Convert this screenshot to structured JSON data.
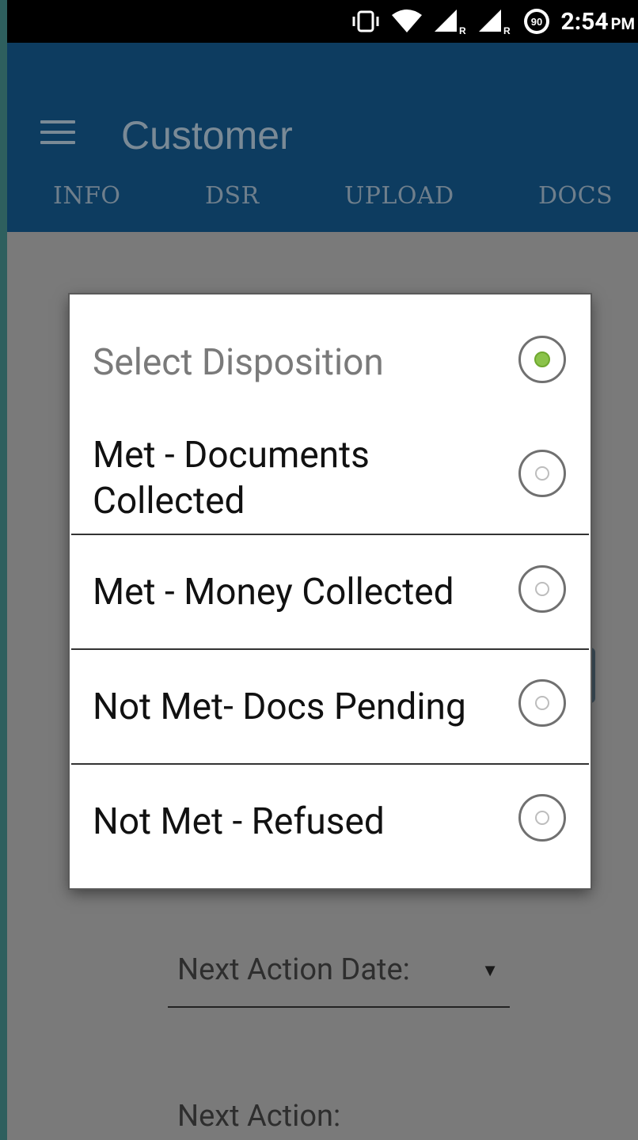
{
  "status_bar": {
    "time": "2:54",
    "ampm": "PM",
    "battery_level": "90",
    "icons": [
      "vibrate-icon",
      "wifi-icon",
      "signal-roaming-icon",
      "signal-roaming-icon",
      "battery-saver-icon"
    ]
  },
  "appbar": {
    "title": "Customer",
    "menu_icon": "hamburger-menu-icon",
    "tabs": [
      {
        "label": "INFO"
      },
      {
        "label": "DSR"
      },
      {
        "label": "UPLOAD"
      },
      {
        "label": "DOCS"
      }
    ]
  },
  "dialog": {
    "options": [
      {
        "label": "Select Disposition",
        "selected": true
      },
      {
        "label": "Met - Documents Collected",
        "selected": false
      },
      {
        "label": "Met - Money Collected",
        "selected": false
      },
      {
        "label": "Not Met- Docs Pending",
        "selected": false
      },
      {
        "label": "Not Met - Refused",
        "selected": false
      }
    ]
  },
  "form": {
    "next_action_date_label": "Next Action Date:",
    "next_action_label": "Next Action:"
  },
  "colors": {
    "appbar": "#0d3c60",
    "radio_selected": "#8bc34a",
    "overlay": "#7a7a7a"
  }
}
